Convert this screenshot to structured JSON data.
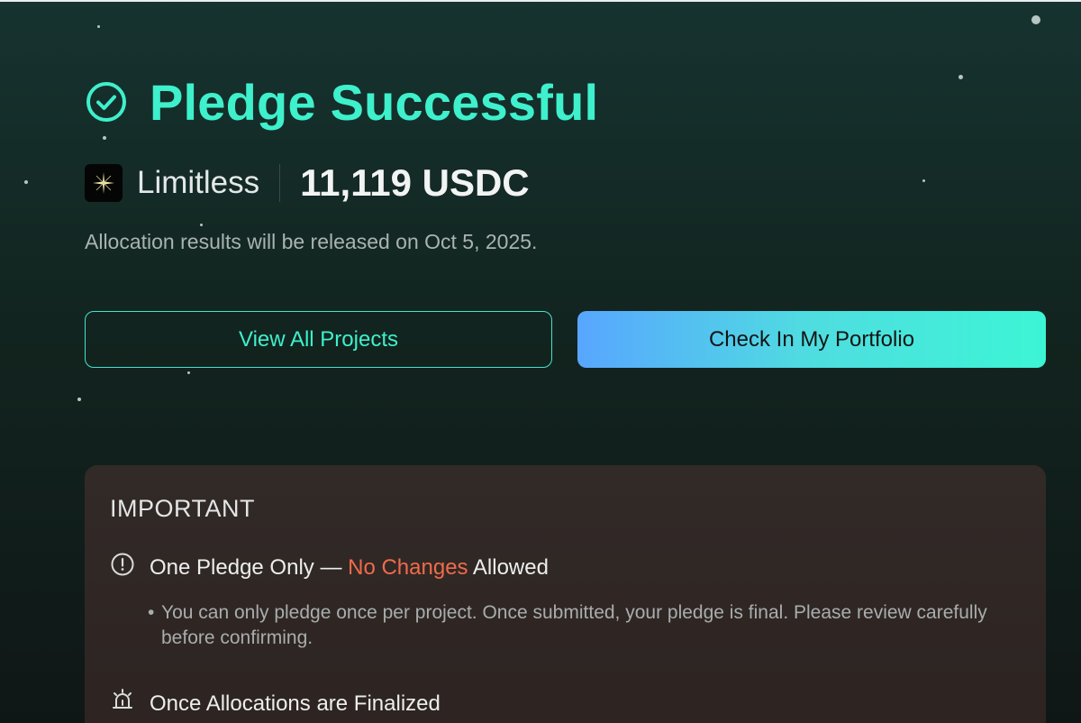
{
  "header": {
    "title": "Pledge Successful",
    "title_icon": "check-circle-icon"
  },
  "project": {
    "name": "Limitless",
    "logo_icon": "limitless-star-logo",
    "amount": "11,119 USDC"
  },
  "notice": "Allocation results will be released on Oct 5, 2025.",
  "buttons": {
    "view_all": "View All Projects",
    "portfolio": "Check In My Portfolio"
  },
  "important": {
    "heading": "IMPORTANT",
    "rules": [
      {
        "icon": "exclamation-circle-icon",
        "title_prefix": "One Pledge Only — ",
        "title_accent": "No Changes",
        "title_suffix": " Allowed",
        "description": "You can only pledge once per project. Once submitted, your pledge is final. Please review carefully before confirming."
      },
      {
        "icon": "alarm-bell-icon",
        "title": "Once Allocations are Finalized"
      }
    ]
  },
  "colors": {
    "accent": "#3ef0cc",
    "warning": "#f06b4b",
    "background": "#163330",
    "card": "#322a27"
  }
}
